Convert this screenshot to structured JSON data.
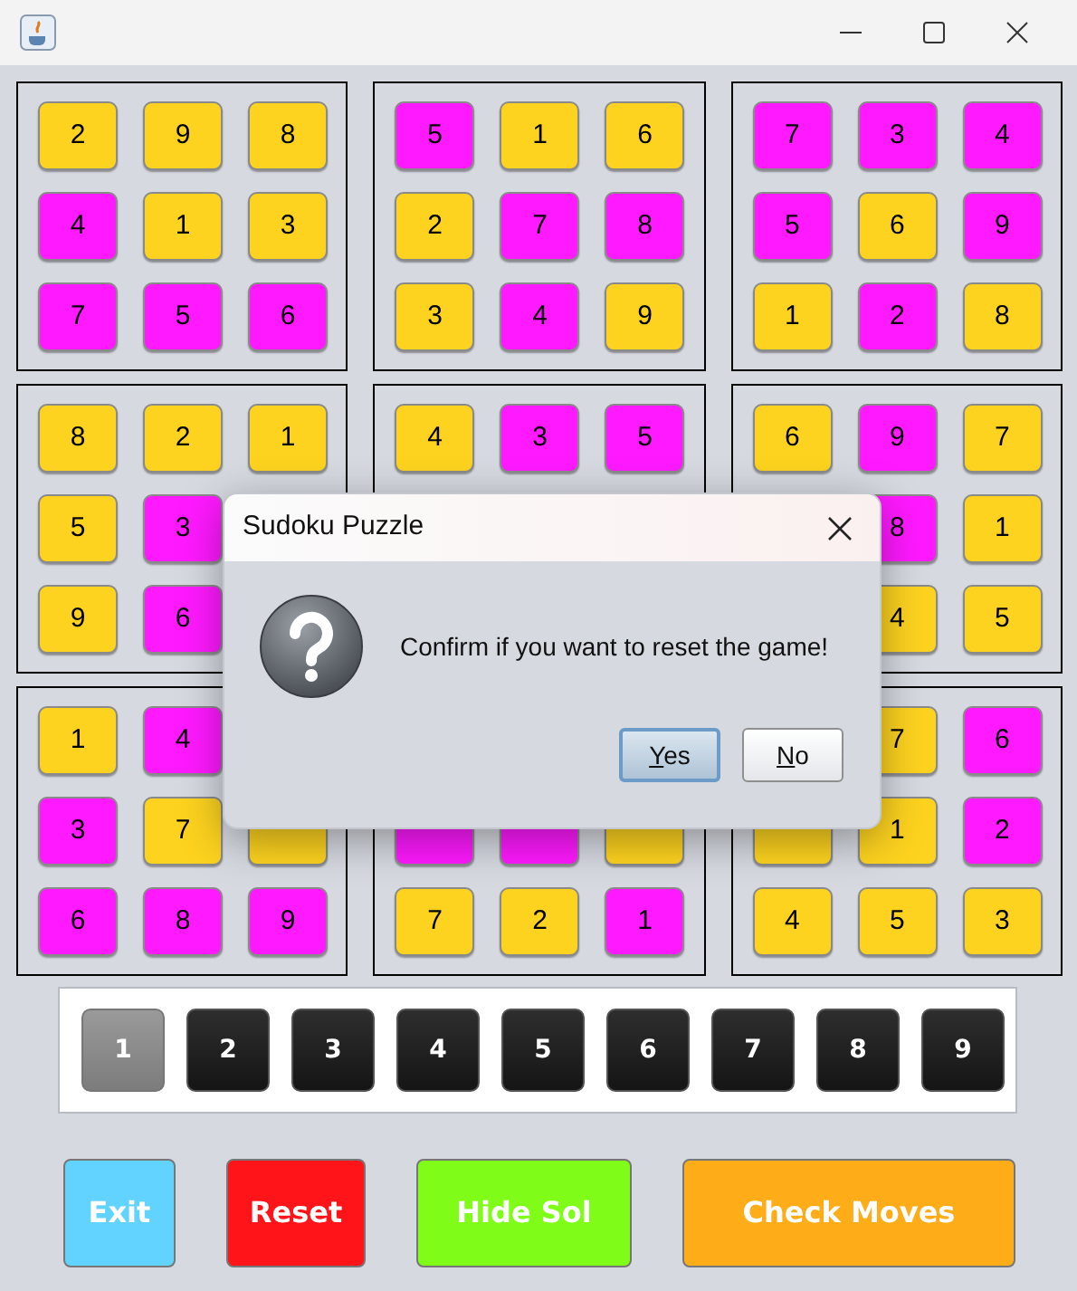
{
  "blocks": [
    {
      "cells": [
        {
          "value": "2",
          "color": "#fdd31f"
        },
        {
          "value": "9",
          "color": "#fdd31f"
        },
        {
          "value": "8",
          "color": "#fdd31f"
        },
        {
          "value": "4",
          "color": "#ff19ff"
        },
        {
          "value": "1",
          "color": "#fdd31f"
        },
        {
          "value": "3",
          "color": "#fdd31f"
        },
        {
          "value": "7",
          "color": "#ff19ff"
        },
        {
          "value": "5",
          "color": "#ff19ff"
        },
        {
          "value": "6",
          "color": "#ff19ff"
        }
      ]
    },
    {
      "cells": [
        {
          "value": "5",
          "color": "#ff19ff"
        },
        {
          "value": "1",
          "color": "#fdd31f"
        },
        {
          "value": "6",
          "color": "#fdd31f"
        },
        {
          "value": "2",
          "color": "#fdd31f"
        },
        {
          "value": "7",
          "color": "#ff19ff"
        },
        {
          "value": "8",
          "color": "#ff19ff"
        },
        {
          "value": "3",
          "color": "#fdd31f"
        },
        {
          "value": "4",
          "color": "#ff19ff"
        },
        {
          "value": "9",
          "color": "#fdd31f"
        }
      ]
    },
    {
      "cells": [
        {
          "value": "7",
          "color": "#ff19ff"
        },
        {
          "value": "3",
          "color": "#ff19ff"
        },
        {
          "value": "4",
          "color": "#ff19ff"
        },
        {
          "value": "5",
          "color": "#ff19ff"
        },
        {
          "value": "6",
          "color": "#fdd31f"
        },
        {
          "value": "9",
          "color": "#ff19ff"
        },
        {
          "value": "1",
          "color": "#fdd31f"
        },
        {
          "value": "2",
          "color": "#ff19ff"
        },
        {
          "value": "8",
          "color": "#fdd31f"
        }
      ]
    },
    {
      "cells": [
        {
          "value": "8",
          "color": "#fdd31f"
        },
        {
          "value": "2",
          "color": "#fdd31f"
        },
        {
          "value": "1",
          "color": "#fdd31f"
        },
        {
          "value": "5",
          "color": "#fdd31f"
        },
        {
          "value": "3",
          "color": "#ff19ff"
        },
        null,
        {
          "value": "9",
          "color": "#fdd31f"
        },
        {
          "value": "6",
          "color": "#ff19ff"
        },
        null
      ]
    },
    {
      "cells": [
        {
          "value": "4",
          "color": "#fdd31f"
        },
        {
          "value": "3",
          "color": "#ff19ff"
        },
        {
          "value": "5",
          "color": "#ff19ff"
        },
        null,
        null,
        null,
        null,
        null,
        null
      ]
    },
    {
      "cells": [
        {
          "value": "6",
          "color": "#fdd31f"
        },
        {
          "value": "9",
          "color": "#ff19ff"
        },
        {
          "value": "7",
          "color": "#fdd31f"
        },
        null,
        {
          "value": "8",
          "color": "#ff19ff"
        },
        {
          "value": "1",
          "color": "#fdd31f"
        },
        null,
        {
          "value": "4",
          "color": "#fdd31f"
        },
        {
          "value": "5",
          "color": "#fdd31f"
        }
      ]
    },
    {
      "cells": [
        {
          "value": "1",
          "color": "#fdd31f"
        },
        {
          "value": "4",
          "color": "#ff19ff"
        },
        null,
        {
          "value": "3",
          "color": "#ff19ff"
        },
        {
          "value": "7",
          "color": "#fdd31f"
        },
        {
          "color": "#fdd31f"
        },
        {
          "value": "6",
          "color": "#ff19ff"
        },
        {
          "value": "8",
          "color": "#ff19ff"
        },
        {
          "value": "9",
          "color": "#ff19ff"
        }
      ]
    },
    {
      "cells": [
        null,
        null,
        null,
        {
          "color": "#ff19ff"
        },
        {
          "color": "#ff19ff"
        },
        {
          "color": "#fdd31f"
        },
        {
          "value": "7",
          "color": "#fdd31f"
        },
        {
          "value": "2",
          "color": "#fdd31f"
        },
        {
          "value": "1",
          "color": "#ff19ff"
        }
      ]
    },
    {
      "cells": [
        null,
        {
          "value": "7",
          "color": "#fdd31f"
        },
        {
          "value": "6",
          "color": "#ff19ff"
        },
        {
          "color": "#fdd31f"
        },
        {
          "value": "1",
          "color": "#fdd31f"
        },
        {
          "value": "2",
          "color": "#ff19ff"
        },
        {
          "value": "4",
          "color": "#fdd31f"
        },
        {
          "value": "5",
          "color": "#fdd31f"
        },
        {
          "value": "3",
          "color": "#fdd31f"
        }
      ]
    }
  ],
  "number_picker": [
    {
      "label": "1",
      "selected": true
    },
    {
      "label": "2",
      "selected": false
    },
    {
      "label": "3",
      "selected": false
    },
    {
      "label": "4",
      "selected": false
    },
    {
      "label": "5",
      "selected": false
    },
    {
      "label": "6",
      "selected": false
    },
    {
      "label": "7",
      "selected": false
    },
    {
      "label": "8",
      "selected": false
    },
    {
      "label": "9",
      "selected": false
    }
  ],
  "actions": [
    {
      "label": "Exit",
      "color": "#62d3fe"
    },
    {
      "label": "Reset",
      "color": "#ff1519"
    },
    {
      "label": "Hide Sol",
      "color": "#7ffd18"
    },
    {
      "label": "Check Moves",
      "color": "#fead18"
    }
  ],
  "dialog": {
    "title": "Sudoku Puzzle",
    "message": "Confirm if you want to reset the game!",
    "buttons": [
      {
        "label": "Yes",
        "focused": true
      },
      {
        "label": "No",
        "focused": false
      }
    ]
  }
}
